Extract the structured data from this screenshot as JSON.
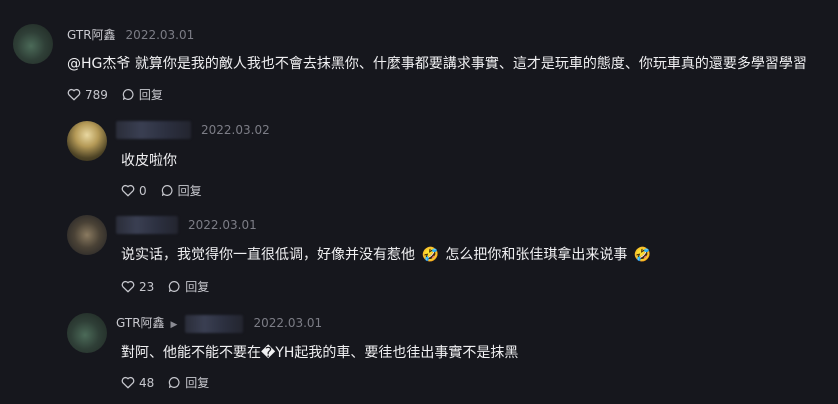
{
  "comments": [
    {
      "user": "GTR阿鑫",
      "date": "2022.03.01",
      "text": "@HG杰爷 就算你是我的敵人我也不會去抹黑你、什麼事都要講求事實、這才是玩車的態度、你玩車真的還要多學習學習",
      "likes": "789",
      "reply_label": "回复"
    },
    {
      "user": "",
      "date": "2022.03.02",
      "text": "收皮啦你",
      "likes": "0",
      "reply_label": "回复"
    },
    {
      "user": "",
      "date": "2022.03.01",
      "text_part1": "说实话，我觉得你一直很低调，好像并没有惹他",
      "emoji1": "🤣",
      "text_part2": "怎么把你和张佳琪拿出来说事",
      "emoji2": "🤣",
      "likes": "23",
      "reply_label": "回复"
    },
    {
      "user": "GTR阿鑫",
      "reply_to": "",
      "date": "2022.03.01",
      "text": "對阿、他能不能不要在�YH起我的車、要徍也徍出事實不是抹黑",
      "likes": "48",
      "reply_label": "回复"
    }
  ],
  "icons": {
    "like": "heart-icon",
    "reply": "reply-bubble-icon",
    "reply_arrow": "caret-right-icon"
  }
}
